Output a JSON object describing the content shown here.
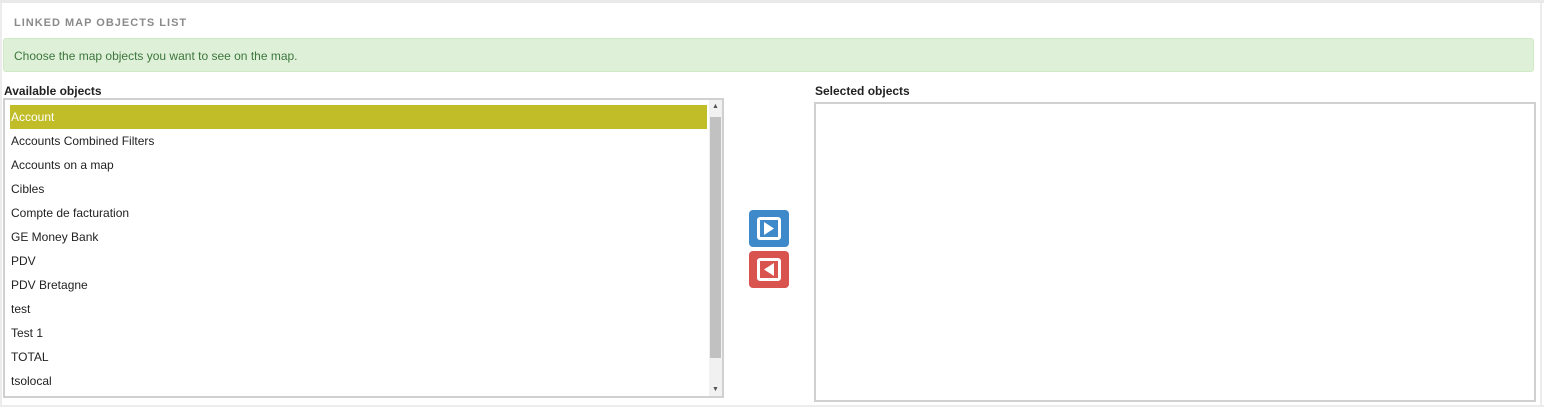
{
  "panel": {
    "title": "LINKED MAP OBJECTS LIST",
    "info": "Choose the map objects you want to see on the map."
  },
  "available": {
    "label": "Available objects",
    "items": [
      "Account",
      "Accounts Combined Filters",
      "Accounts on a map",
      "Cibles",
      "Compte de facturation",
      "GE Money Bank",
      "PDV",
      "PDV Bretagne",
      "test",
      "Test 1",
      "TOTAL",
      "tsolocal"
    ],
    "selected_item": "Account"
  },
  "selected": {
    "label": "Selected objects",
    "items": []
  },
  "buttons": {
    "add_icon": "arrow-right-icon",
    "remove_icon": "arrow-left-icon"
  },
  "colors": {
    "highlight": "#c0bd28",
    "info_bg": "#dff0d8",
    "info_text": "#3c763d",
    "add_button": "#3d89c9",
    "remove_button": "#d9534f"
  }
}
